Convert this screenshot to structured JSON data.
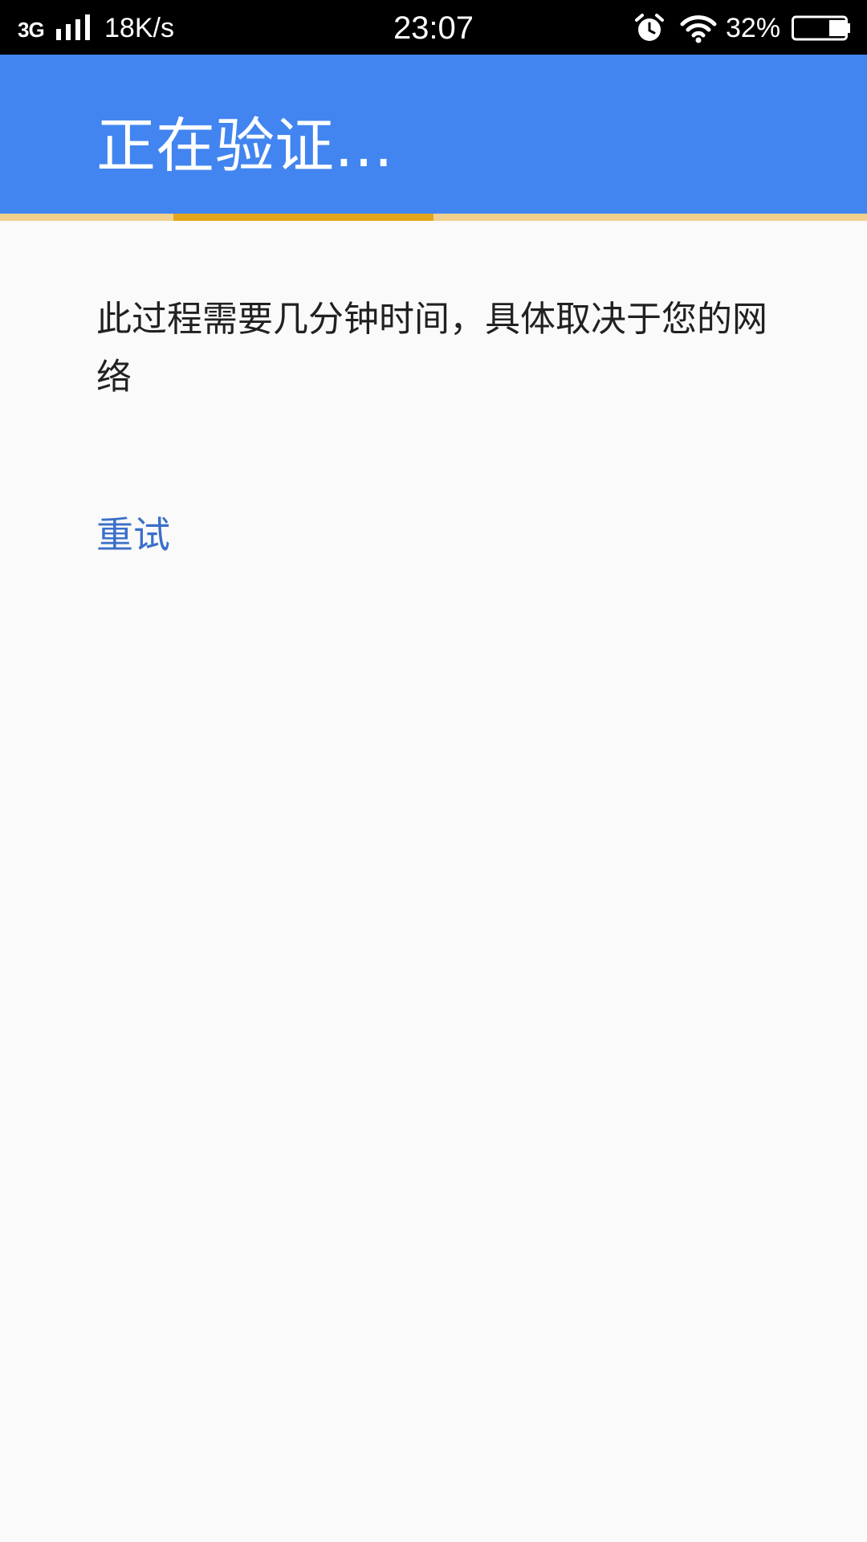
{
  "status_bar": {
    "network_type": "3G",
    "speed": "18K/s",
    "time": "23:07",
    "battery": "32%",
    "battery_level": 0.32,
    "icons": [
      "signal-icon",
      "alarm-icon",
      "wifi-icon",
      "battery-icon"
    ]
  },
  "app_bar": {
    "title": "正在验证…",
    "background_color": "#4285f0"
  },
  "progress": {
    "track_color": "#f0d08c",
    "indicator_color": "#e4a51c"
  },
  "content": {
    "message": "此过程需要几分钟时间，具体取决于您的网络",
    "retry_label": "重试",
    "link_color": "#3b6fc9"
  }
}
